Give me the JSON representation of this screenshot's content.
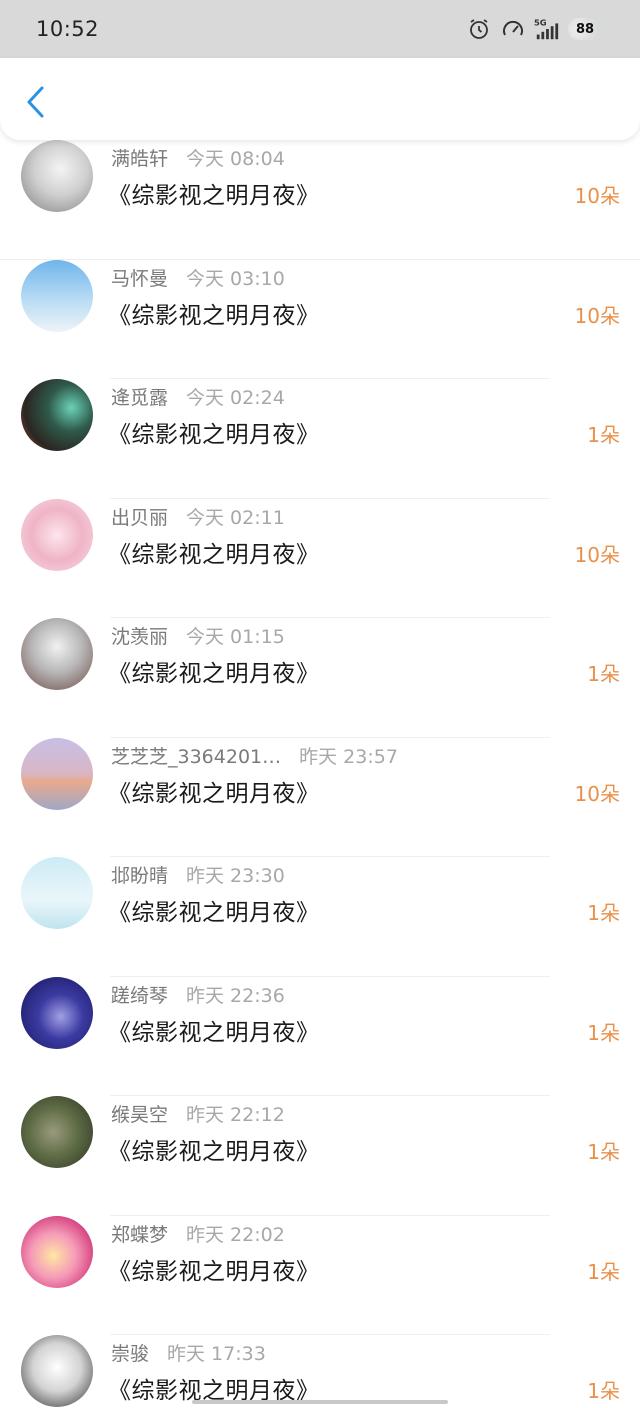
{
  "status_bar": {
    "time": "10:52",
    "battery": "88",
    "icons": [
      "alarm-icon",
      "speedometer-icon",
      "signal-5g-icon"
    ]
  },
  "nav": {
    "back_icon": "chevron-left-icon"
  },
  "colors": {
    "accent": "#2a92e0",
    "amount": "#e9904a"
  },
  "items": [
    {
      "name": "满皓轩",
      "time": "今天 08:04",
      "title": "《综影视之明月夜》",
      "amount": "10朵"
    },
    {
      "name": "马怀曼",
      "time": "今天 03:10",
      "title": "《综影视之明月夜》",
      "amount": "10朵"
    },
    {
      "name": "逄觅露",
      "time": "今天 02:24",
      "title": "《综影视之明月夜》",
      "amount": "1朵"
    },
    {
      "name": "出贝丽",
      "time": "今天 02:11",
      "title": "《综影视之明月夜》",
      "amount": "10朵"
    },
    {
      "name": "沈羡丽",
      "time": "今天 01:15",
      "title": "《综影视之明月夜》",
      "amount": "1朵"
    },
    {
      "name": "芝芝芝_3364201…",
      "time": "昨天 23:57",
      "title": "《综影视之明月夜》",
      "amount": "10朵"
    },
    {
      "name": "邶盼晴",
      "time": "昨天 23:30",
      "title": "《综影视之明月夜》",
      "amount": "1朵"
    },
    {
      "name": "蹉绮琴",
      "time": "昨天 22:36",
      "title": "《综影视之明月夜》",
      "amount": "1朵"
    },
    {
      "name": "缑昊空",
      "time": "昨天 22:12",
      "title": "《综影视之明月夜》",
      "amount": "1朵"
    },
    {
      "name": "郑蝶梦",
      "time": "昨天 22:02",
      "title": "《综影视之明月夜》",
      "amount": "1朵"
    },
    {
      "name": "崇骏",
      "time": "昨天 17:33",
      "title": "《综影视之明月夜》",
      "amount": "1朵"
    }
  ]
}
